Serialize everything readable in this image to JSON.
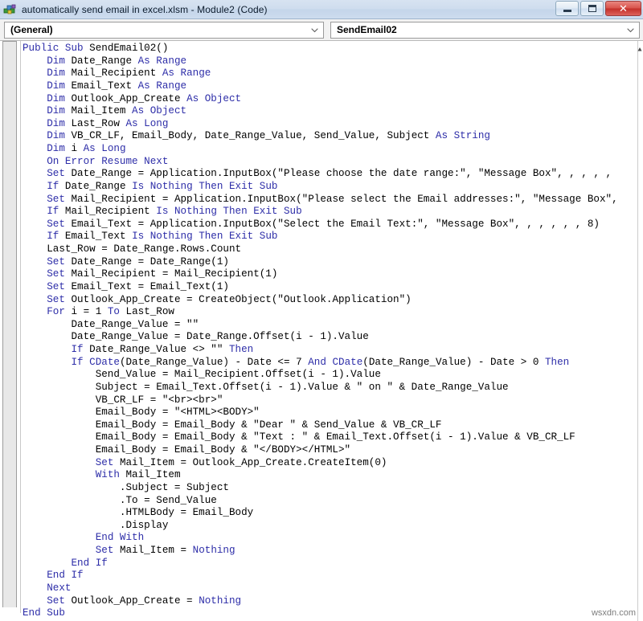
{
  "window": {
    "icon_name": "vba-module-icon",
    "title": "automatically send email in excel.xlsm - Module2 (Code)",
    "buttons": {
      "minimize": "minimize-button",
      "restore": "restore-button",
      "close_label": "✕"
    }
  },
  "toolbar": {
    "object_dropdown": {
      "value": "(General)",
      "arrow_icon": "chevron-down-icon"
    },
    "procedure_dropdown": {
      "value": "SendEmail02",
      "arrow_icon": "chevron-down-icon"
    }
  },
  "editor": {
    "scrollbar": {
      "up_arrow_icon": "scroll-up-arrow-icon"
    },
    "code_lines": [
      [
        [
          "kw",
          "Public Sub "
        ],
        [
          "id",
          "SendEmail02()"
        ]
      ],
      [
        [
          "id",
          "    "
        ],
        [
          "kw",
          "Dim "
        ],
        [
          "id",
          "Date_Range "
        ],
        [
          "kw",
          "As Range"
        ]
      ],
      [
        [
          "id",
          "    "
        ],
        [
          "kw",
          "Dim "
        ],
        [
          "id",
          "Mail_Recipient "
        ],
        [
          "kw",
          "As Range"
        ]
      ],
      [
        [
          "id",
          "    "
        ],
        [
          "kw",
          "Dim "
        ],
        [
          "id",
          "Email_Text "
        ],
        [
          "kw",
          "As Range"
        ]
      ],
      [
        [
          "id",
          "    "
        ],
        [
          "kw",
          "Dim "
        ],
        [
          "id",
          "Outlook_App_Create "
        ],
        [
          "kw",
          "As Object"
        ]
      ],
      [
        [
          "id",
          "    "
        ],
        [
          "kw",
          "Dim "
        ],
        [
          "id",
          "Mail_Item "
        ],
        [
          "kw",
          "As Object"
        ]
      ],
      [
        [
          "id",
          "    "
        ],
        [
          "kw",
          "Dim "
        ],
        [
          "id",
          "Last_Row "
        ],
        [
          "kw",
          "As Long"
        ]
      ],
      [
        [
          "id",
          "    "
        ],
        [
          "kw",
          "Dim "
        ],
        [
          "id",
          "VB_CR_LF, Email_Body, Date_Range_Value, Send_Value, Subject "
        ],
        [
          "kw",
          "As String"
        ]
      ],
      [
        [
          "id",
          "    "
        ],
        [
          "kw",
          "Dim "
        ],
        [
          "id",
          "i "
        ],
        [
          "kw",
          "As Long"
        ]
      ],
      [
        [
          "id",
          "    "
        ],
        [
          "kw",
          "On Error Resume Next"
        ]
      ],
      [
        [
          "id",
          "    "
        ],
        [
          "kw",
          "Set "
        ],
        [
          "id",
          "Date_Range = Application.InputBox(\"Please choose the date range:\", \"Message Box\", , , , ,"
        ]
      ],
      [
        [
          "id",
          "    "
        ],
        [
          "kw",
          "If "
        ],
        [
          "id",
          "Date_Range "
        ],
        [
          "kw",
          "Is Nothing Then Exit Sub"
        ]
      ],
      [
        [
          "id",
          "    "
        ],
        [
          "kw",
          "Set "
        ],
        [
          "id",
          "Mail_Recipient = Application.InputBox(\"Please select the Email addresses:\", \"Message Box\","
        ]
      ],
      [
        [
          "id",
          "    "
        ],
        [
          "kw",
          "If "
        ],
        [
          "id",
          "Mail_Recipient "
        ],
        [
          "kw",
          "Is Nothing Then Exit Sub"
        ]
      ],
      [
        [
          "id",
          "    "
        ],
        [
          "kw",
          "Set "
        ],
        [
          "id",
          "Email_Text = Application.InputBox(\"Select the Email Text:\", \"Message Box\", , , , , , 8)"
        ]
      ],
      [
        [
          "id",
          "    "
        ],
        [
          "kw",
          "If "
        ],
        [
          "id",
          "Email_Text "
        ],
        [
          "kw",
          "Is Nothing Then Exit Sub"
        ]
      ],
      [
        [
          "id",
          "    "
        ],
        [
          "id",
          "Last_Row = Date_Range.Rows.Count"
        ]
      ],
      [
        [
          "id",
          "    "
        ],
        [
          "kw",
          "Set "
        ],
        [
          "id",
          "Date_Range = Date_Range(1)"
        ]
      ],
      [
        [
          "id",
          "    "
        ],
        [
          "kw",
          "Set "
        ],
        [
          "id",
          "Mail_Recipient = Mail_Recipient(1)"
        ]
      ],
      [
        [
          "id",
          "    "
        ],
        [
          "kw",
          "Set "
        ],
        [
          "id",
          "Email_Text = Email_Text(1)"
        ]
      ],
      [
        [
          "id",
          "    "
        ],
        [
          "kw",
          "Set "
        ],
        [
          "id",
          "Outlook_App_Create = CreateObject(\"Outlook.Application\")"
        ]
      ],
      [
        [
          "id",
          "    "
        ],
        [
          "kw",
          "For "
        ],
        [
          "id",
          "i = 1 "
        ],
        [
          "kw",
          "To "
        ],
        [
          "id",
          "Last_Row"
        ]
      ],
      [
        [
          "id",
          "        Date_Range_Value = \"\""
        ]
      ],
      [
        [
          "id",
          "        Date_Range_Value = Date_Range.Offset(i - 1).Value"
        ]
      ],
      [
        [
          "id",
          "        "
        ],
        [
          "kw",
          "If "
        ],
        [
          "id",
          "Date_Range_Value <> \"\" "
        ],
        [
          "kw",
          "Then"
        ]
      ],
      [
        [
          "id",
          "        "
        ],
        [
          "kw",
          "If CDate"
        ],
        [
          "id",
          "(Date_Range_Value) - Date <= 7 "
        ],
        [
          "kw",
          "And CDate"
        ],
        [
          "id",
          "(Date_Range_Value) - Date > 0 "
        ],
        [
          "kw",
          "Then"
        ]
      ],
      [
        [
          "id",
          "            Send_Value = Mail_Recipient.Offset(i - 1).Value"
        ]
      ],
      [
        [
          "id",
          "            Subject = Email_Text.Offset(i - 1).Value & \" on \" & Date_Range_Value"
        ]
      ],
      [
        [
          "id",
          "            VB_CR_LF = \"<br><br>\""
        ]
      ],
      [
        [
          "id",
          "            Email_Body = \"<HTML><BODY>\""
        ]
      ],
      [
        [
          "id",
          "            Email_Body = Email_Body & \"Dear \" & Send_Value & VB_CR_LF"
        ]
      ],
      [
        [
          "id",
          "            Email_Body = Email_Body & \"Text : \" & Email_Text.Offset(i - 1).Value & VB_CR_LF"
        ]
      ],
      [
        [
          "id",
          "            Email_Body = Email_Body & \"</BODY></HTML>\""
        ]
      ],
      [
        [
          "id",
          "            "
        ],
        [
          "kw",
          "Set "
        ],
        [
          "id",
          "Mail_Item = Outlook_App_Create.CreateItem(0)"
        ]
      ],
      [
        [
          "id",
          "            "
        ],
        [
          "kw",
          "With "
        ],
        [
          "id",
          "Mail_Item"
        ]
      ],
      [
        [
          "id",
          "                .Subject = Subject"
        ]
      ],
      [
        [
          "id",
          "                .To = Send_Value"
        ]
      ],
      [
        [
          "id",
          "                .HTMLBody = Email_Body"
        ]
      ],
      [
        [
          "id",
          "                .Display"
        ]
      ],
      [
        [
          "id",
          "            "
        ],
        [
          "kw",
          "End With"
        ]
      ],
      [
        [
          "id",
          "            "
        ],
        [
          "kw",
          "Set "
        ],
        [
          "id",
          "Mail_Item = "
        ],
        [
          "kw",
          "Nothing"
        ]
      ],
      [
        [
          "id",
          "        "
        ],
        [
          "kw",
          "End If"
        ]
      ],
      [
        [
          "id",
          "    "
        ],
        [
          "kw",
          "End If"
        ]
      ],
      [
        [
          "id",
          "    "
        ],
        [
          "kw",
          "Next"
        ]
      ],
      [
        [
          "id",
          "    "
        ],
        [
          "kw",
          "Set "
        ],
        [
          "id",
          "Outlook_App_Create = "
        ],
        [
          "kw",
          "Nothing"
        ]
      ],
      [
        [
          "kw",
          "End Sub"
        ]
      ]
    ]
  },
  "watermark": {
    "text": "wsxdn.com"
  },
  "colors": {
    "keyword": "#2d2da8",
    "text": "#000000",
    "titlebar": "#cddcee",
    "close_button": "#c3302a"
  }
}
